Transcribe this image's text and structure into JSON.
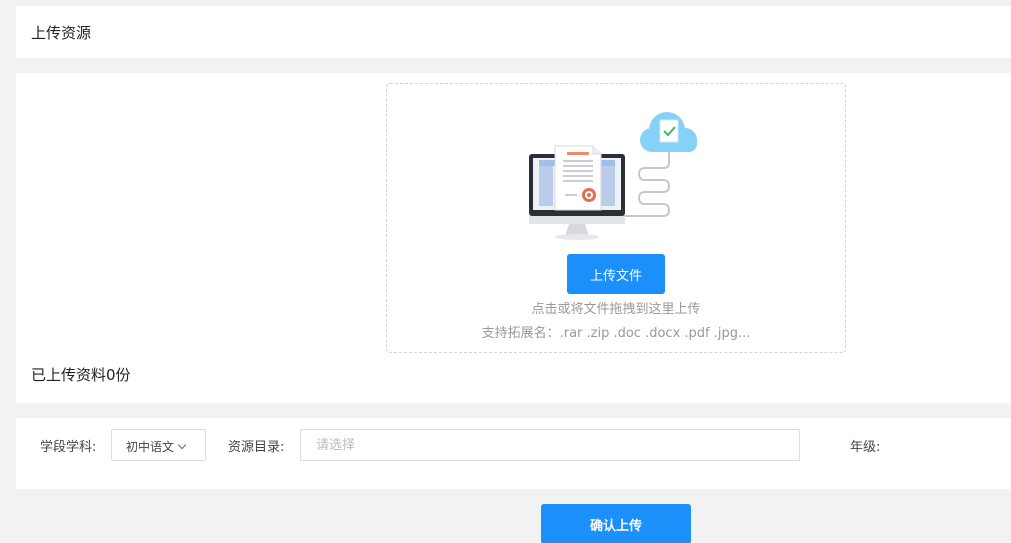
{
  "header": {
    "title": "上传资源"
  },
  "upload": {
    "button_label": "上传文件",
    "hint": "点击或将文件拖拽到这里上传",
    "extensions": "支持拓展名：.rar .zip .doc .docx .pdf .jpg...",
    "illustration_icon": "cloud-upload-computer-illustration"
  },
  "uploaded": {
    "count_text": "已上传资料0份"
  },
  "meta": {
    "stage_label": "学段学科:",
    "stage_value": "初中语文",
    "dir_label": "资源目录:",
    "dir_placeholder": "请选择",
    "grade_label": "年级:"
  },
  "footer": {
    "confirm_label": "确认上传"
  },
  "colors": {
    "accent": "#1b8ffa",
    "page_bg": "#f2f2f2",
    "cloud": "#86d1f7"
  }
}
